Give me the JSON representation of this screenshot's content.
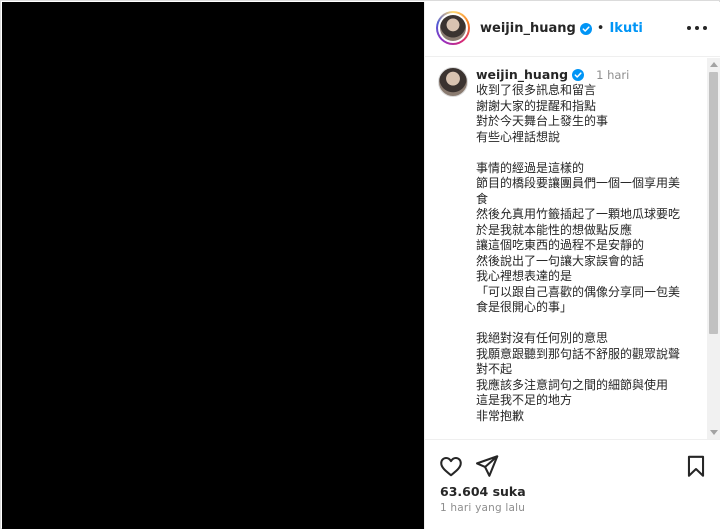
{
  "post": {
    "username": "weijin_huang",
    "separator": "•",
    "follow_label": "Ikuti",
    "caption_username": "weijin_huang",
    "caption_time": "1 hari",
    "caption_lines": [
      "收到了很多訊息和留言",
      "謝謝大家的提醒和指點",
      "對於今天舞台上發生的事",
      "有些心裡話想說",
      "",
      "事情的經過是這樣的",
      "節目的橋段要讓團員們一個一個享用美",
      "食",
      "然後允真用竹籤插起了一顆地瓜球要吃",
      "於是我就本能性的想做點反應",
      "讓這個吃東西的過程不是安靜的",
      "然後說出了一句讓大家誤會的話",
      "我心裡想表達的是",
      "「可以跟自己喜歡的偶像分享同一包美",
      "食是很開心的事」",
      "",
      "我絕對沒有任何別的意思",
      "我願意跟聽到那句話不舒服的觀眾說聲",
      "對不起",
      "我應該多注意詞句之間的細節與使用",
      "這是我不足的地方",
      "非常抱歉"
    ],
    "likes": "63.604 suka",
    "posted_time": "1 hari yang lalu"
  },
  "icons": {
    "verified": "verified-badge-icon",
    "more": "more-options-icon",
    "like": "heart-icon",
    "share": "paper-plane-icon",
    "save": "bookmark-icon"
  },
  "colors": {
    "accent": "#0095f6",
    "media_background": "#000000",
    "muted_text": "#8e8e8e"
  }
}
